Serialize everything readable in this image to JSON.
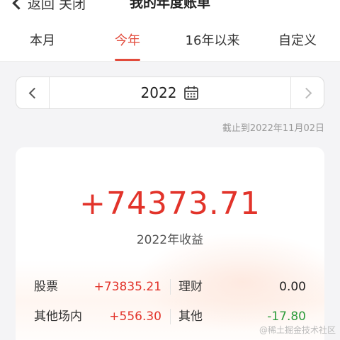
{
  "header": {
    "back_label": "返回",
    "close_label": "关闭",
    "title": "我的年度账单"
  },
  "tabs": [
    {
      "label": "本月",
      "active": false
    },
    {
      "label": "今年",
      "active": true
    },
    {
      "label": "16年以来",
      "active": false
    },
    {
      "label": "自定义",
      "active": false
    }
  ],
  "year_selector": {
    "year": "2022",
    "prev_icon": "chevron-left-icon",
    "next_icon": "chevron-right-icon",
    "calendar_icon": "calendar-icon"
  },
  "as_of_text": "截止到2022年11月02日",
  "summary": {
    "total_value": "+74373.71",
    "total_label": "2022年收益",
    "rows": [
      {
        "left_label": "股票",
        "left_value": "+73835.21",
        "right_label": "理财",
        "right_value": "0.00"
      },
      {
        "left_label": "其他场内",
        "left_value": "+556.30",
        "right_label": "其他",
        "right_value": "-17.80"
      }
    ]
  },
  "watermark": "@稀土掘金技术社区",
  "colors": {
    "accent": "#e24a3b",
    "gain": "#e2332a",
    "loss": "#2b9b3a"
  }
}
